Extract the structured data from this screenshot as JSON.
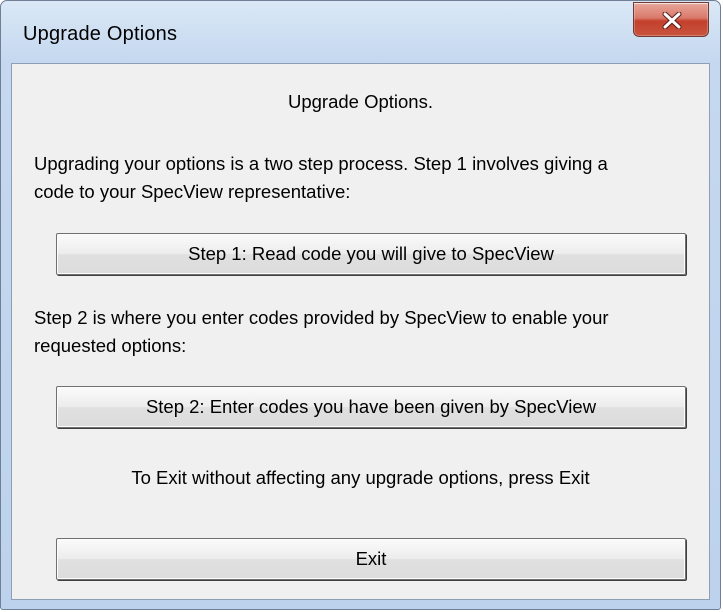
{
  "window": {
    "title": "Upgrade Options"
  },
  "content": {
    "heading": "Upgrade Options.",
    "step1_text_line1": "Upgrading your options is a two step process.  Step 1 involves giving a",
    "step1_text_line2": "code to your SpecView representative:",
    "step1_button": "Step 1: Read code you will give to SpecView",
    "step2_text_line1": "Step 2 is where you enter codes provided by SpecView to enable your",
    "step2_text_line2": "requested options:",
    "step2_button": "Step 2: Enter codes you have been given by SpecView",
    "exit_note": "To Exit without affecting any upgrade options, press Exit",
    "exit_button": "Exit"
  },
  "icons": {
    "close": "close-icon"
  },
  "colors": {
    "close_button": "#c9543f",
    "client_background": "#f0f0f0",
    "frame": "#c5d8ef"
  }
}
